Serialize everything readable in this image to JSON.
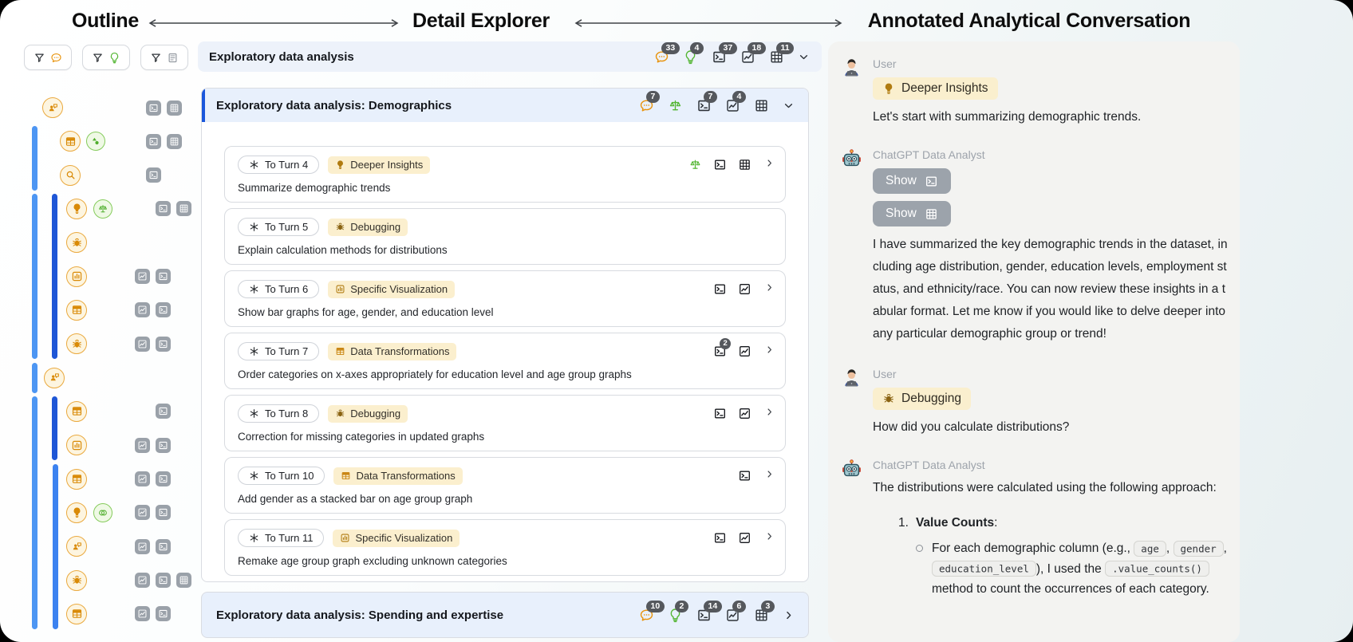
{
  "header": {
    "titles": [
      "Outline",
      "Detail Explorer",
      "Annotated Analytical Conversation"
    ]
  },
  "outline": {
    "filters": [
      {
        "icons": [
          "funnel-icon",
          "speech-icon"
        ]
      },
      {
        "icons": [
          "funnel-icon",
          "lightbulb-icon"
        ]
      },
      {
        "icons": [
          "funnel-icon",
          "data-icon"
        ]
      }
    ],
    "rows": [
      {
        "icon": "user-prompt",
        "secondary": null,
        "buttons": [
          "terminal",
          "table"
        ]
      },
      {
        "icon": "table",
        "secondary": "shapes",
        "buttons": [
          "terminal",
          "table"
        ]
      },
      {
        "icon": "search",
        "secondary": null,
        "buttons": [
          "terminal"
        ]
      },
      {
        "icon": "lightbulb",
        "secondary": "scale",
        "buttons": [
          "terminal",
          "table"
        ]
      },
      {
        "icon": "bug",
        "secondary": null,
        "buttons": []
      },
      {
        "icon": "bar-chart",
        "secondary": null,
        "buttons": [
          "chart",
          "terminal"
        ]
      },
      {
        "icon": "table",
        "secondary": null,
        "buttons": [
          "chart",
          "terminal"
        ]
      },
      {
        "icon": "bug",
        "secondary": null,
        "buttons": [
          "chart",
          "terminal"
        ]
      },
      {
        "icon": "user-prompt",
        "secondary": null,
        "buttons": []
      },
      {
        "icon": "table",
        "secondary": null,
        "buttons": [
          "terminal"
        ]
      },
      {
        "icon": "bar-chart",
        "secondary": null,
        "buttons": [
          "chart",
          "terminal"
        ]
      },
      {
        "icon": "table",
        "secondary": null,
        "buttons": [
          "chart",
          "terminal"
        ]
      },
      {
        "icon": "lightbulb",
        "secondary": "venn",
        "buttons": [
          "chart",
          "terminal"
        ]
      },
      {
        "icon": "user-prompt",
        "secondary": null,
        "buttons": [
          "chart",
          "terminal"
        ]
      },
      {
        "icon": "bug",
        "secondary": null,
        "buttons": [
          "chart",
          "terminal",
          "table"
        ]
      },
      {
        "icon": "table",
        "secondary": null,
        "buttons": [
          "chart",
          "terminal"
        ]
      }
    ]
  },
  "explorer": {
    "header": {
      "title": "Exploratory data analysis",
      "counts": {
        "messages": "33",
        "insights": "4",
        "code": "37",
        "charts": "18",
        "tables": "11"
      }
    },
    "sections": [
      {
        "title": "Exploratory data analysis: Demographics",
        "counts": {
          "messages": "7",
          "code": "7",
          "charts": "4"
        },
        "cards": [
          {
            "turn_label": "To Turn 4",
            "tag": {
              "icon": "lightbulb",
              "label": "Deeper Insights"
            },
            "body": "Summarize demographic trends",
            "icons": [
              "scale",
              "terminal",
              "table"
            ]
          },
          {
            "turn_label": "To Turn 5",
            "tag": {
              "icon": "bug",
              "label": "Debugging"
            },
            "body": "Explain calculation methods for distributions",
            "icons": []
          },
          {
            "turn_label": "To Turn 6",
            "tag": {
              "icon": "chart",
              "label": "Specific Visualization"
            },
            "body": "Show bar graphs for age, gender, and education level",
            "icons": [
              "terminal",
              "chart"
            ]
          },
          {
            "turn_label": "To Turn 7",
            "tag": {
              "icon": "grid",
              "label": "Data Transformations"
            },
            "body": "Order categories on x-axes appropriately for education level and age group graphs",
            "icons": [
              "terminal",
              "chart"
            ],
            "terminal_badge": "2"
          },
          {
            "turn_label": "To Turn 8",
            "tag": {
              "icon": "bug",
              "label": "Debugging"
            },
            "body": "Correction for missing categories in updated graphs",
            "icons": [
              "terminal",
              "chart"
            ]
          },
          {
            "turn_label": "To Turn 10",
            "tag": {
              "icon": "grid",
              "label": "Data Transformations"
            },
            "body": "Add gender as a stacked bar on age group graph",
            "icons": [
              "terminal"
            ]
          },
          {
            "turn_label": "To Turn 11",
            "tag": {
              "icon": "chart",
              "label": "Specific Visualization"
            },
            "body": "Remake age group graph excluding unknown categories",
            "icons": [
              "terminal",
              "chart"
            ]
          }
        ]
      },
      {
        "title": "Exploratory data analysis: Spending and expertise",
        "counts": {
          "messages": "10",
          "insights": "2",
          "code": "14",
          "charts": "6",
          "tables": "3"
        }
      }
    ]
  },
  "conversation": {
    "messages": [
      {
        "author": "User",
        "tag": {
          "icon": "lightbulb",
          "label": "Deeper Insights"
        },
        "text": "Let's start with summarizing demographic trends."
      },
      {
        "author": "ChatGPT Data Analyst",
        "buttons": [
          {
            "label": "Show",
            "icon": "terminal"
          },
          {
            "label": "Show",
            "icon": "table"
          }
        ],
        "text": "I have summarized the key demographic trends in the dataset, including age distribution, gender, education levels, employment status, and ethnicity/race. You can now review these insights in a tabular format. Let me know if you would like to delve deeper into any particular demographic group or trend!"
      },
      {
        "author": "User",
        "tag": {
          "icon": "bug",
          "label": "Debugging"
        },
        "text": "How did you calculate distributions?"
      },
      {
        "author": "ChatGPT Data Analyst",
        "text": "The distributions were calculated using the following approach:",
        "list": {
          "marker": "1.",
          "title": "Value Counts",
          "title_suffix": ":",
          "bullet": [
            {
              "t": "text",
              "v": "For each demographic column (e.g., "
            },
            {
              "t": "code",
              "v": "age"
            },
            {
              "t": "text",
              "v": ", "
            },
            {
              "t": "code",
              "v": "gender"
            },
            {
              "t": "text",
              "v": ", "
            },
            {
              "t": "code",
              "v": "education_level"
            },
            {
              "t": "text",
              "v": "), I used the "
            },
            {
              "t": "code",
              "v": ".value_counts()"
            },
            {
              "t": "text",
              "v": " method to count the occurrences of each category."
            }
          ]
        }
      }
    ]
  }
}
